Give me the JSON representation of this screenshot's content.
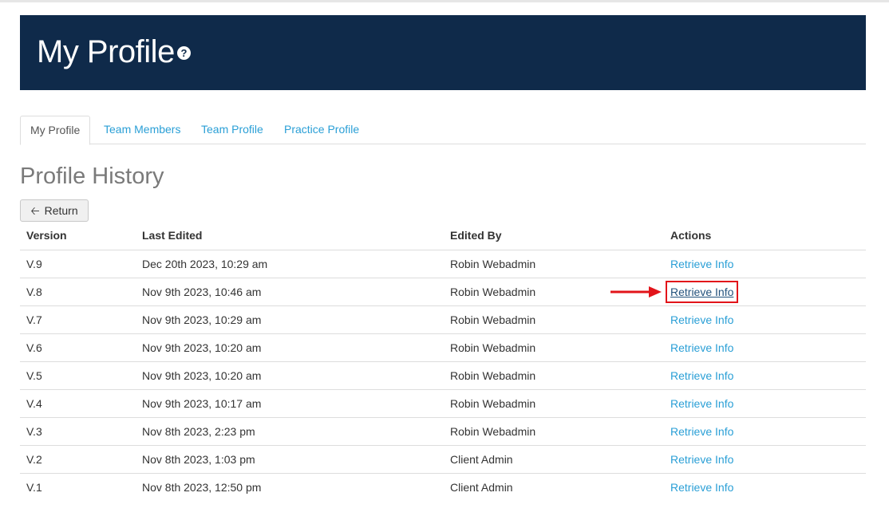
{
  "header": {
    "title": "My Profile",
    "help_icon": "question-circle-icon"
  },
  "tabs": [
    {
      "label": "My Profile",
      "active": true
    },
    {
      "label": "Team Members",
      "active": false
    },
    {
      "label": "Team Profile",
      "active": false
    },
    {
      "label": "Practice Profile",
      "active": false
    }
  ],
  "section_title": "Profile History",
  "return_button": {
    "label": "Return",
    "icon": "arrow-left-icon"
  },
  "table": {
    "headers": {
      "version": "Version",
      "last_edited": "Last Edited",
      "edited_by": "Edited By",
      "actions": "Actions"
    },
    "rows": [
      {
        "version": "V.9",
        "last_edited": "Dec 20th 2023, 10:29 am",
        "edited_by": "Robin Webadmin",
        "action": "Retrieve Info"
      },
      {
        "version": "V.8",
        "last_edited": "Nov 9th 2023, 10:46 am",
        "edited_by": "Robin Webadmin",
        "action": "Retrieve Info"
      },
      {
        "version": "V.7",
        "last_edited": "Nov 9th 2023, 10:29 am",
        "edited_by": "Robin Webadmin",
        "action": "Retrieve Info"
      },
      {
        "version": "V.6",
        "last_edited": "Nov 9th 2023, 10:20 am",
        "edited_by": "Robin Webadmin",
        "action": "Retrieve Info"
      },
      {
        "version": "V.5",
        "last_edited": "Nov 9th 2023, 10:20 am",
        "edited_by": "Robin Webadmin",
        "action": "Retrieve Info"
      },
      {
        "version": "V.4",
        "last_edited": "Nov 9th 2023, 10:17 am",
        "edited_by": "Robin Webadmin",
        "action": "Retrieve Info"
      },
      {
        "version": "V.3",
        "last_edited": "Nov 8th 2023, 2:23 pm",
        "edited_by": "Robin Webadmin",
        "action": "Retrieve Info"
      },
      {
        "version": "V.2",
        "last_edited": "Nov 8th 2023, 1:03 pm",
        "edited_by": "Client Admin",
        "action": "Retrieve Info"
      },
      {
        "version": "V.1",
        "last_edited": "Nov 8th 2023, 12:50 pm",
        "edited_by": "Client Admin",
        "action": "Retrieve Info"
      }
    ]
  },
  "colors": {
    "header_bg": "#0f2a4a",
    "link": "#2a9fd6",
    "highlight": "#e2141a"
  }
}
